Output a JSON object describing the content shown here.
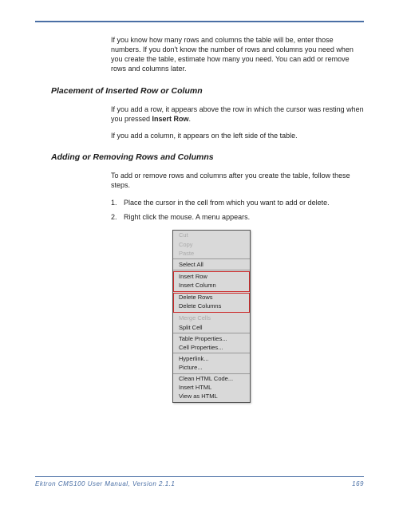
{
  "intro_para": "If you know how many rows and columns the table will be, enter those numbers. If you don't know the number of rows and columns you need when you create the table, estimate how many you need. You can add or remove rows and columns later.",
  "section1": {
    "heading": "Placement of Inserted Row or Column",
    "para1_prefix": "If you add a row, it appears above the row in which the cursor was resting when you pressed ",
    "para1_bold": "Insert Row",
    "para1_suffix": ".",
    "para2": "If you add a column, it appears on the left side of the table."
  },
  "section2": {
    "heading": "Adding or Removing Rows and Columns",
    "intro": "To add or remove rows and columns after you create the table, follow these steps.",
    "steps": [
      "Place the cursor in the cell from which you want to add or delete.",
      "Right click the mouse. A menu appears."
    ]
  },
  "context_menu": {
    "groups": [
      {
        "items": [
          "Cut",
          "Copy",
          "Paste"
        ],
        "disabled": true,
        "highlighted": false
      },
      {
        "items": [
          "Select All"
        ],
        "disabled": false,
        "highlighted": false
      },
      {
        "items": [
          "Insert Row",
          "Insert Column"
        ],
        "disabled": false,
        "highlighted": true
      },
      {
        "items": [
          "Delete Rows",
          "Delete Columns"
        ],
        "disabled": false,
        "highlighted": true
      },
      {
        "items": [
          "Merge Cells",
          "Split Cell"
        ],
        "disabled_first": true
      },
      {
        "items": [
          "Table Properties...",
          "Cell Properties..."
        ],
        "disabled": false,
        "highlighted": false
      },
      {
        "items": [
          "Hyperlink...",
          "Picture..."
        ],
        "disabled": false,
        "highlighted": false
      },
      {
        "items": [
          "Clean HTML Code...",
          "Insert HTML",
          "View as HTML"
        ],
        "disabled": false,
        "highlighted": false
      }
    ]
  },
  "footer": {
    "left": "Ektron CMS100 User Manual, Version 2.1.1",
    "right": "169"
  }
}
